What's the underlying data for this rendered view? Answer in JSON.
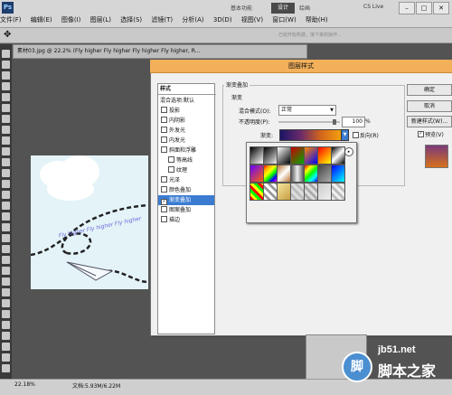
{
  "menubar": {
    "logo": "Ps",
    "items": [
      "文件(F)",
      "编辑(E)",
      "图像(I)",
      "图层(L)",
      "选择(S)",
      "滤镜(T)",
      "分析(A)",
      "3D(D)",
      "视图(V)",
      "窗口(W)",
      "帮助(H)"
    ],
    "workspaces": {
      "basic": "基本功能",
      "design": "设计",
      "paint": "绘画"
    },
    "cs_live": "CS Live",
    "window_buttons": [
      "–",
      "□",
      "✕"
    ]
  },
  "options_bar": {
    "tool_icon": "move-tool-icon",
    "hint": "已经开始构建，接下来的操作..."
  },
  "document": {
    "tab_title": "素材03.jpg @ 22.2% (Fly higher Fly higher Fly higher Fly higher, R...",
    "canvas_text": "Fly higher Fly higher Fly higher",
    "zoom": "22.18%",
    "doc_size": "文档:5.93M/6.22M"
  },
  "dialog": {
    "title": "图层样式",
    "styles_header": "样式",
    "styles": [
      {
        "label": "混合选项:默认",
        "checked": null,
        "selected": false
      },
      {
        "label": "投影",
        "checked": false,
        "selected": false
      },
      {
        "label": "内阴影",
        "checked": false,
        "selected": false
      },
      {
        "label": "外发光",
        "checked": false,
        "selected": false
      },
      {
        "label": "内发光",
        "checked": false,
        "selected": false
      },
      {
        "label": "斜面和浮雕",
        "checked": false,
        "selected": false
      },
      {
        "label": "等高线",
        "checked": false,
        "selected": false
      },
      {
        "label": "纹理",
        "checked": false,
        "selected": false
      },
      {
        "label": "光泽",
        "checked": false,
        "selected": false
      },
      {
        "label": "颜色叠加",
        "checked": false,
        "selected": false
      },
      {
        "label": "渐变叠加",
        "checked": true,
        "selected": true
      },
      {
        "label": "图案叠加",
        "checked": false,
        "selected": false
      },
      {
        "label": "描边",
        "checked": false,
        "selected": false
      }
    ],
    "group_title": "渐变叠加",
    "subgroup_title": "渐变",
    "blend_mode_label": "混合模式(O):",
    "blend_mode_value": "正常",
    "opacity_label": "不透明度(P):",
    "opacity_value": "100",
    "opacity_unit": "%",
    "gradient_label": "渐变:",
    "reverse_label": "反向(R)",
    "buttons": {
      "ok": "确定",
      "cancel": "取消",
      "new_style": "新建样式(W)...",
      "preview": "预览(V)"
    }
  },
  "gradient_presets": [
    "linear-gradient(135deg,#000,#fff)",
    "linear-gradient(135deg,#000,#888 60%,transparent)",
    "linear-gradient(135deg,#fff,#000)",
    "linear-gradient(135deg,#c00,#0a0)",
    "linear-gradient(135deg,#f80,#00f)",
    "linear-gradient(135deg,#f00,#ff0)",
    "linear-gradient(135deg,#000,#fff,#000)",
    "linear-gradient(135deg,#60f,#f60)",
    "linear-gradient(135deg,#f00,#fa0,#ff0,#0f0,#00f,#f0f)",
    "linear-gradient(135deg,#b87333,#fff,#b87333)",
    "linear-gradient(90deg,#555,#eee,#555)",
    "linear-gradient(135deg,#f00,#ff0,#0f0,#0ff,#00f)",
    "linear-gradient(135deg,#444,#aaa)",
    "linear-gradient(135deg,#00f,#0ff)",
    "repeating-linear-gradient(45deg,#f00 0 3px,#ff0 3px 6px,#0f0 6px 9px)",
    "repeating-linear-gradient(45deg,#fff 0 3px,#999 3px 6px)",
    "linear-gradient(135deg,#f4e4a0,#c8a040)",
    "repeating-linear-gradient(45deg,#ddd 0 3px,#bbb 3px 6px)",
    "repeating-linear-gradient(45deg,#ddd 0 3px,#aaa 3px 6px)",
    "linear-gradient(135deg,#ccc,#eee)",
    "repeating-linear-gradient(45deg,#eee 0 3px,#bbb 3px 6px)"
  ],
  "watermark": {
    "url": "jb51.net",
    "home": "脚本之家",
    "logo": "脚"
  }
}
